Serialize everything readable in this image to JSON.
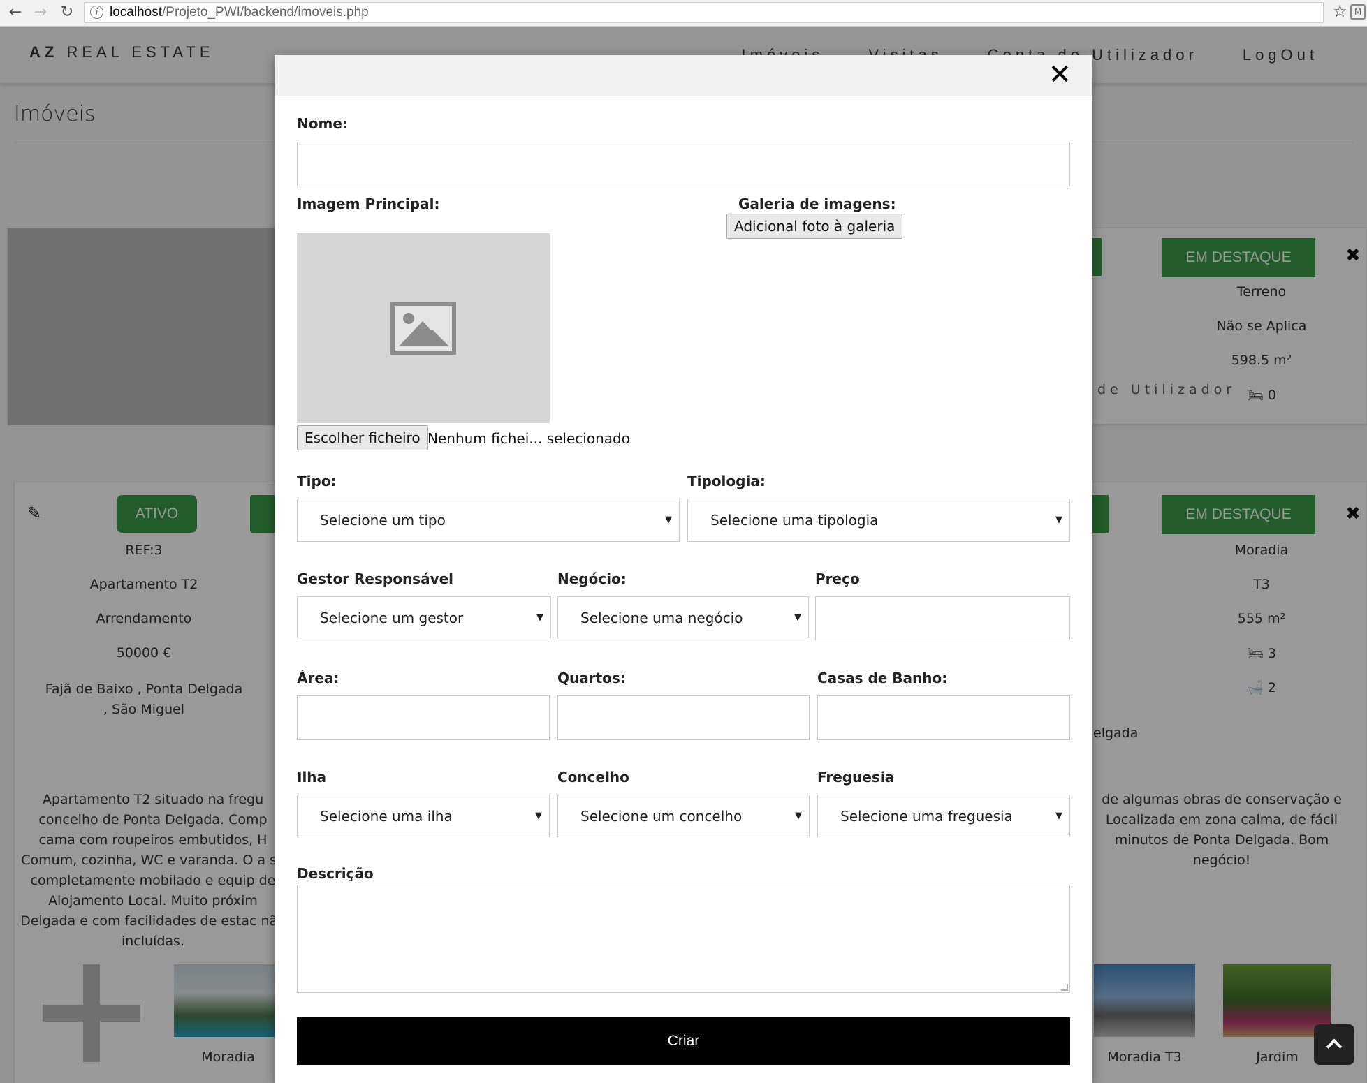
{
  "browser": {
    "url_host": "localhost",
    "url_path": "/Projeto_PWI/backend/imoveis.php"
  },
  "nav": {
    "brand_bold": "AZ",
    "brand_rest": "REAL ESTATE",
    "links": [
      "Imóveis",
      "Visitas",
      "Conta de Utilizador",
      "LogOut"
    ]
  },
  "page": {
    "title": "Imóveis"
  },
  "card1": {
    "badge_right": "EM DESTAQUE",
    "info_right": [
      "Terreno",
      "Não se Aplica",
      "598.5 m²",
      "0"
    ],
    "ghost_text": "de Utilizador"
  },
  "card2": {
    "badge_left": "ATIVO",
    "badge_right": "EM DESTAQUE",
    "info_left": [
      "REF:3",
      "Apartamento T2",
      "Arrendamento",
      "50000 €"
    ],
    "address_left": "Fajã de Baixo , Ponta Delgada , São Miguel",
    "info_right": [
      "Moradia",
      "T3",
      "555 m²",
      "3",
      "2"
    ],
    "partial_address_right": "elgada",
    "description_left": "Apartamento T2 situado na fregu concelho de Ponta Delgada. Comp cama com roupeiros embutidos, H Comum, cozinha, WC e varanda. O a se completamente mobilado e equip de Alojamento Local. Muito próxim Delgada e com facilidades de estac não incluídas.",
    "description_right": "de algumas obras de conservação e Localizada em zona calma, de fácil minutos de Ponta Delgada. Bom negócio!",
    "gallery": [
      "Moradia",
      "Moradia T3",
      "Jardim"
    ]
  },
  "modal": {
    "labels": {
      "nome": "Nome:",
      "imagem_principal": "Imagem Principal:",
      "galeria": "Galeria de imagens:",
      "tipo": "Tipo:",
      "tipologia": "Tipologia:",
      "gestor": "Gestor Responsável",
      "negocio": "Negócio:",
      "preco": "Preço",
      "area": "Área:",
      "quartos": "Quartos:",
      "casas_banho": "Casas de Banho:",
      "ilha": "Ilha",
      "concelho": "Concelho",
      "freguesia": "Freguesia",
      "descricao": "Descrição"
    },
    "file_button": "Escolher ficheiro",
    "file_status": "Nenhum fichei... selecionado",
    "gallery_button": "Adicional foto à galeria",
    "selects": {
      "tipo": "Selecione um tipo",
      "tipologia": "Selecione uma tipologia",
      "gestor": "Selecione um gestor",
      "negocio": "Selecione uma negócio",
      "ilha": "Selecione uma ilha",
      "concelho": "Selecione um concelho",
      "freguesia": "Selecione uma freguesia"
    },
    "inputs": {
      "nome": "",
      "preco": "",
      "area": "",
      "quartos": "",
      "casas_banho": "",
      "descricao": ""
    },
    "submit": "Criar"
  },
  "colors": {
    "accent_green": "#3a9a46",
    "submit_black": "#000000"
  }
}
